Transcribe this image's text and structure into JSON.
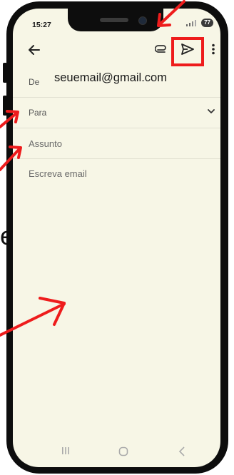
{
  "status": {
    "time": "15:27",
    "battery": "77"
  },
  "compose": {
    "from_label": "De",
    "from_value": "seuemail@gmail.com",
    "to_label": "Para",
    "subject_placeholder": "Assunto",
    "body_placeholder": "Escreva email"
  },
  "background": {
    "partial_text": "e"
  },
  "icons": {
    "back": "arrow-left-icon",
    "attach": "paperclip-icon",
    "send": "send-icon",
    "more": "more-vertical-icon",
    "expand": "chevron-down-icon"
  },
  "colors": {
    "annotation_red": "#ee1c1c",
    "screen_bg": "#f7f6e6"
  }
}
